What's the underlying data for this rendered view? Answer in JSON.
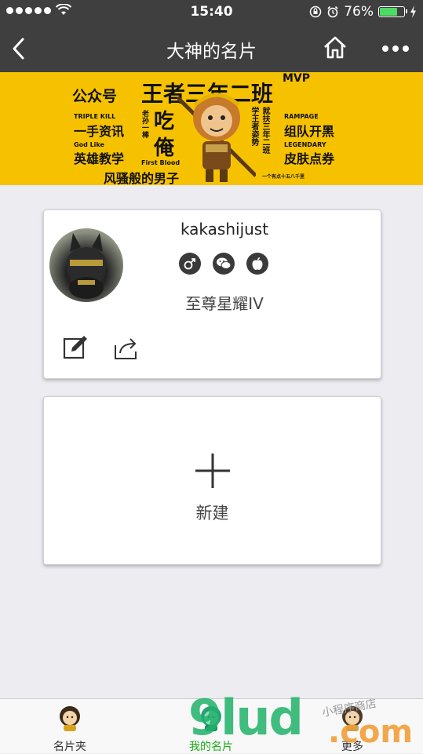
{
  "status_bar": {
    "time": "15:40",
    "battery_text": "76%",
    "battery_level": 0.76
  },
  "nav": {
    "title": "大神的名片"
  },
  "banner": {
    "texts": {
      "gzh": "公众号",
      "main_title": "王者三年二班",
      "mvp": "MVP",
      "triple_kill": "TRIPLE KILL",
      "yishou": "一手资讯",
      "godlike": "God Like",
      "yingxiong": "英雄教学",
      "fengsao": "风骚般的男子",
      "laosun": "老孙一棒",
      "chi": "吃",
      "an": "俺",
      "first_blood": "First Blood",
      "xue": "学王者姿势",
      "jiufu": "就扶三年二班",
      "rampage": "RAMPAGE",
      "zudui": "组队开黑",
      "legendary": "LEGENDARY",
      "pifu": "皮肤点券",
      "footer": "一个有点十五八千里"
    }
  },
  "profile_card": {
    "username": "kakashijust",
    "badges": [
      "male-icon",
      "wechat-icon",
      "apple-icon"
    ],
    "rank": "至尊星耀IV"
  },
  "new_card": {
    "label": "新建"
  },
  "tabbar": {
    "tabs": [
      {
        "label": "名片夹",
        "active": false
      },
      {
        "label": "我的名片",
        "active": true
      },
      {
        "label": "更多",
        "active": false
      }
    ]
  },
  "watermark": {
    "brand": "9lud",
    "domain": ".com",
    "shop": "小程序商店"
  },
  "colors": {
    "nav_bg": "#3f3f3f",
    "banner_bg": "#f6c200",
    "page_bg": "#ececf1",
    "active_tab": "#1aad19",
    "watermark_green": "#21b26b",
    "watermark_orange": "#f39a2e"
  }
}
